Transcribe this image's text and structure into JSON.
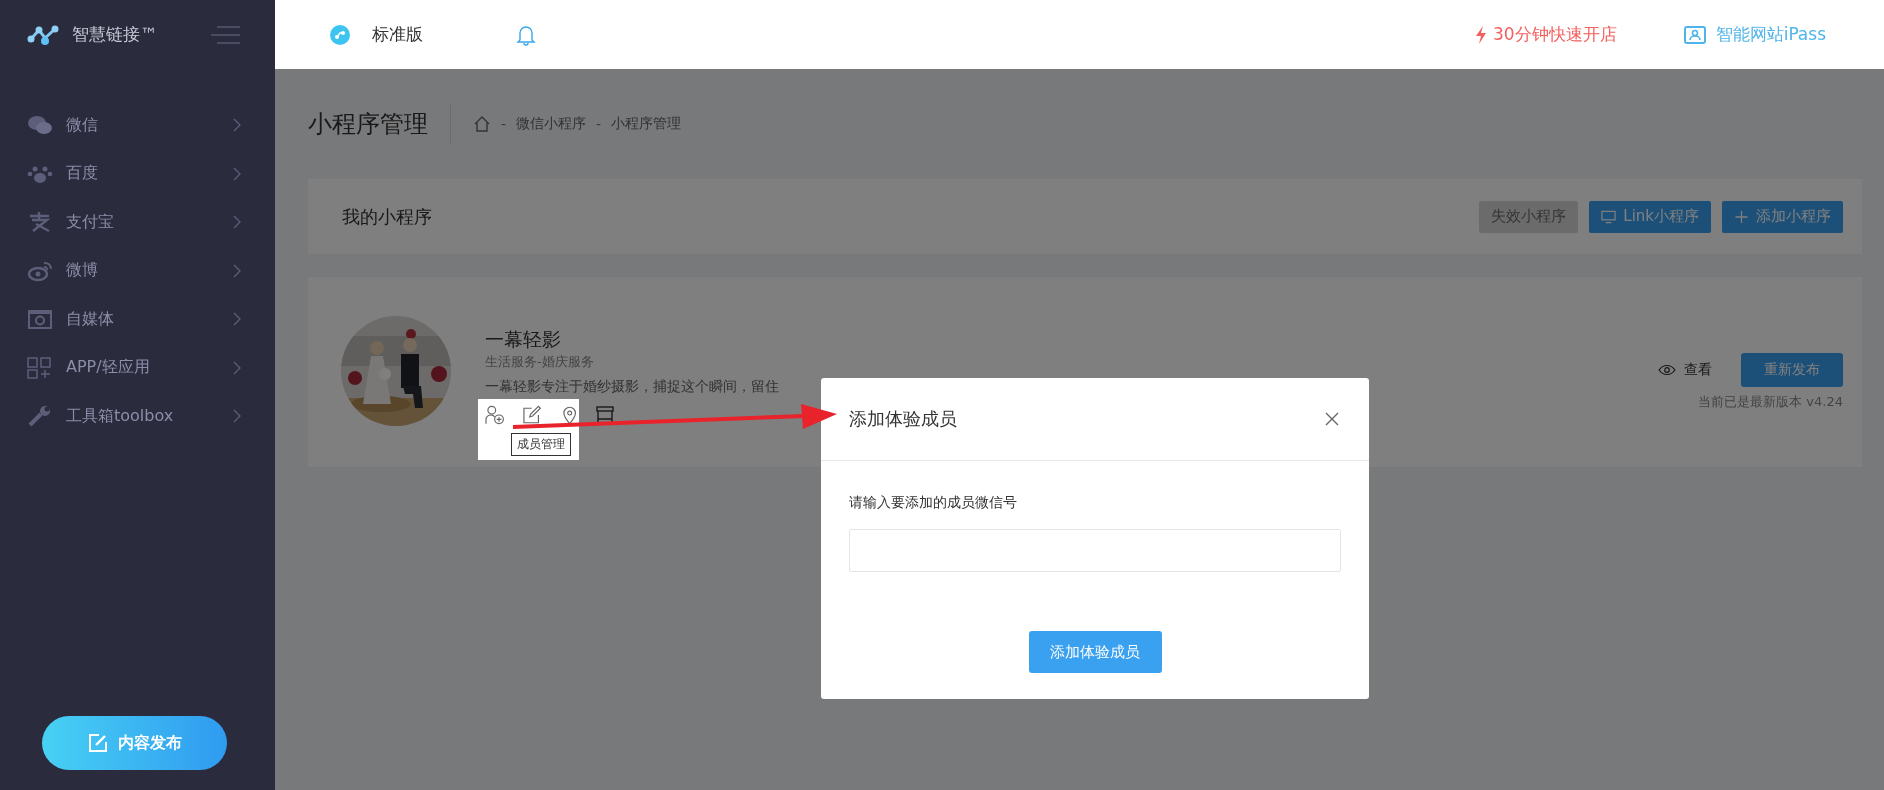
{
  "brand": {
    "name": "智慧链接™"
  },
  "topbar": {
    "edition": "标准版",
    "links": [
      {
        "label": "30分钟快速开店",
        "kind": "promo"
      },
      {
        "label": "智能网站iPass",
        "kind": "site"
      }
    ]
  },
  "sidebar": {
    "items": [
      {
        "label": "微信"
      },
      {
        "label": "百度"
      },
      {
        "label": "支付宝"
      },
      {
        "label": "微博"
      },
      {
        "label": "自媒体"
      },
      {
        "label": "APP/轻应用"
      },
      {
        "label": "工具箱toolbox"
      }
    ],
    "publish_button": "内容发布"
  },
  "page": {
    "title": "小程序管理",
    "separator": "-",
    "breadcrumb": [
      "微信小程序",
      "小程序管理"
    ]
  },
  "header_card": {
    "title": "我的小程序",
    "buttons": [
      {
        "label": "失效小程序",
        "kind": "muted"
      },
      {
        "label": "Link小程序",
        "kind": "link"
      },
      {
        "label": "添加小程序",
        "kind": "add"
      }
    ]
  },
  "app_card": {
    "name": "一幕轻影",
    "category": "生活服务-婚庆服务",
    "description": "一幕轻影专注于婚纱摄影，捕捉这个瞬间，留住",
    "tooltip": "成员管理",
    "view": "查看",
    "republish": "重新发布",
    "version_note": "当前已是最新版本 v4.24"
  },
  "modal": {
    "title": "添加体验成员",
    "label": "请输入要添加的成员微信号",
    "submit": "添加体验成员"
  }
}
